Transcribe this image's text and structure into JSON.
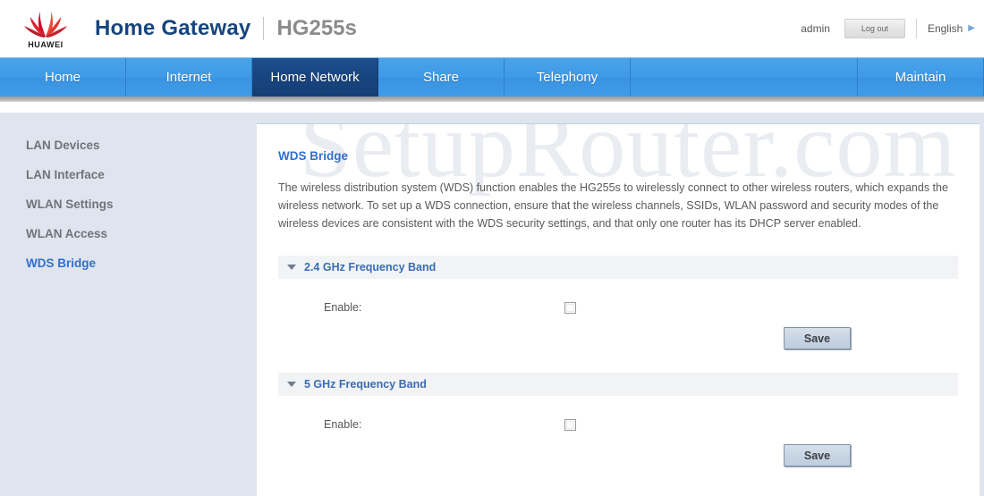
{
  "header": {
    "logo_alt": "HUAWEI",
    "logo_wordmark": "HUAWEI",
    "title": "Home Gateway",
    "model": "HG255s",
    "user": "admin",
    "logout_label": "Log out",
    "language": "English",
    "language_arrow": "▶"
  },
  "nav": {
    "items": [
      {
        "label": "Home",
        "active": false
      },
      {
        "label": "Internet",
        "active": false
      },
      {
        "label": "Home Network",
        "active": true
      },
      {
        "label": "Share",
        "active": false
      },
      {
        "label": "Telephony",
        "active": false
      },
      {
        "label": "",
        "active": false
      },
      {
        "label": "Maintain",
        "active": false
      }
    ]
  },
  "sidebar": {
    "items": [
      {
        "label": "LAN Devices",
        "active": false
      },
      {
        "label": "LAN Interface",
        "active": false
      },
      {
        "label": "WLAN Settings",
        "active": false
      },
      {
        "label": "WLAN Access",
        "active": false
      },
      {
        "label": "WDS Bridge",
        "active": true
      }
    ]
  },
  "main": {
    "watermark": "SetupRouter.com",
    "title": "WDS Bridge",
    "description": "The wireless distribution system (WDS) function enables the HG255s to wirelessly connect to other wireless routers, which expands the wireless network. To set up a WDS connection, ensure that the wireless channels, SSIDs, WLAN password and security modes of the wireless devices are consistent with the WDS security settings, and that only one router has its DHCP server enabled.",
    "sections": [
      {
        "title": "2.4 GHz Frequency Band",
        "enable_label": "Enable:",
        "enable_checked": false,
        "save_label": "Save"
      },
      {
        "title": "5 GHz Frequency Band",
        "enable_label": "Enable:",
        "enable_checked": false,
        "save_label": "Save"
      }
    ]
  },
  "colors": {
    "brand_blue": "#17457e",
    "nav_blue": "#3f9be6",
    "nav_active": "#18447e",
    "link_blue": "#2f6fd0",
    "body_bg": "#dfe5ee"
  }
}
